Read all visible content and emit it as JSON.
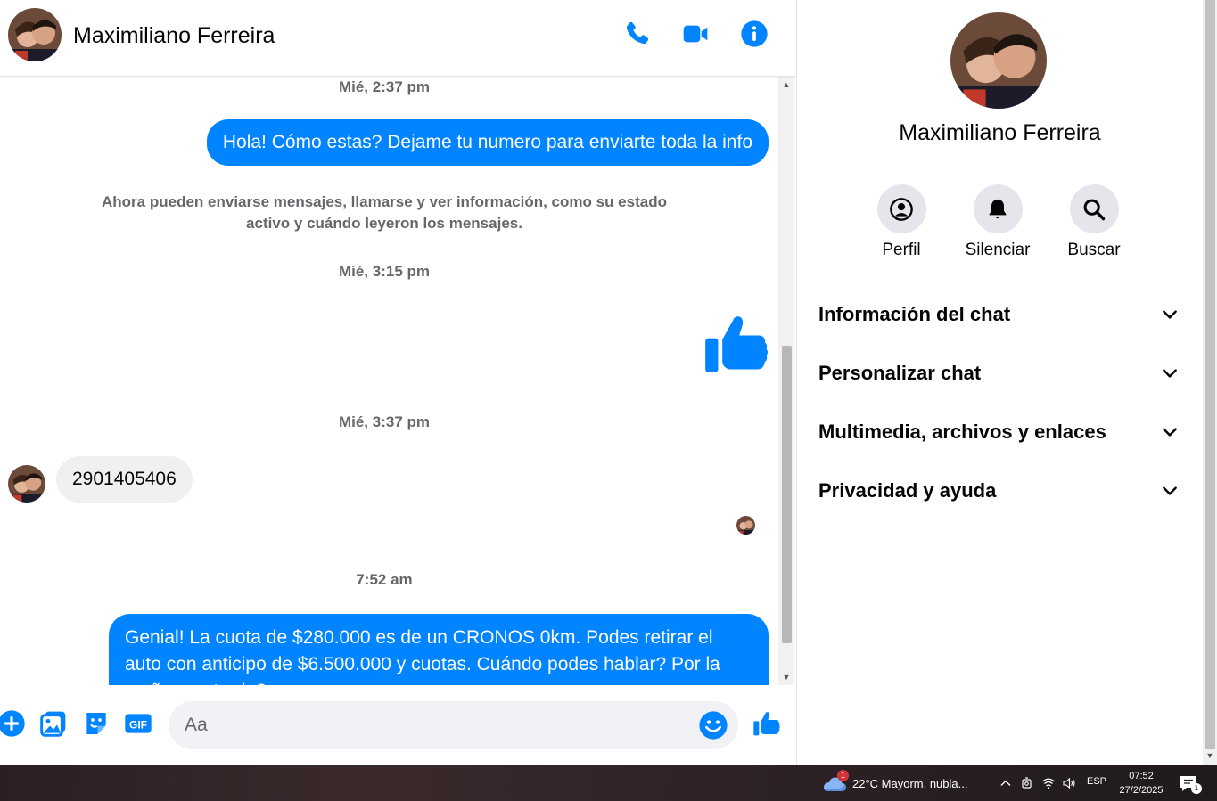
{
  "contact": {
    "name": "Maximiliano Ferreira"
  },
  "header": {
    "call_icon": "phone-icon",
    "video_icon": "video-icon",
    "info_icon": "info-icon"
  },
  "messages": {
    "ts1": "Mié, 2:37 pm",
    "out1": "Hola! Cómo estas? Dejame tu numero para enviarte toda la info",
    "system_note": "Ahora pueden enviarse mensajes, llamarse y ver información, como su estado activo y cuándo leyeron los mensajes.",
    "ts2": "Mié, 3:15 pm",
    "like_icon": "thumbs-up-icon",
    "ts3": "Mié, 3:37 pm",
    "in1": "2901405406",
    "ts4": "7:52 am",
    "out2": "Genial! La cuota de $280.000 es de un CRONOS 0km. Podes retirar el auto con anticipo de $6.500.000 y cuotas. Cuándo podes hablar? Por la mañana o tarde?"
  },
  "composer": {
    "placeholder": "Aa"
  },
  "panel": {
    "actions": [
      {
        "label": "Perfil",
        "icon": "profile-icon"
      },
      {
        "label": "Silenciar",
        "icon": "bell-icon"
      },
      {
        "label": "Buscar",
        "icon": "search-icon"
      }
    ],
    "sections": [
      {
        "label": "Información del chat"
      },
      {
        "label": "Personalizar chat"
      },
      {
        "label": "Multimedia, archivos y enlaces"
      },
      {
        "label": "Privacidad y ayuda"
      }
    ]
  },
  "taskbar": {
    "weather_badge": "1",
    "weather_text": "22°C  Mayorm. nubla...",
    "language": "ESP",
    "time": "07:52",
    "date": "27/2/2025",
    "notifications_count": "1"
  },
  "colors": {
    "accent": "#0084ff",
    "bubble_in": "#f0f0f0",
    "muted_text": "#65676b"
  }
}
